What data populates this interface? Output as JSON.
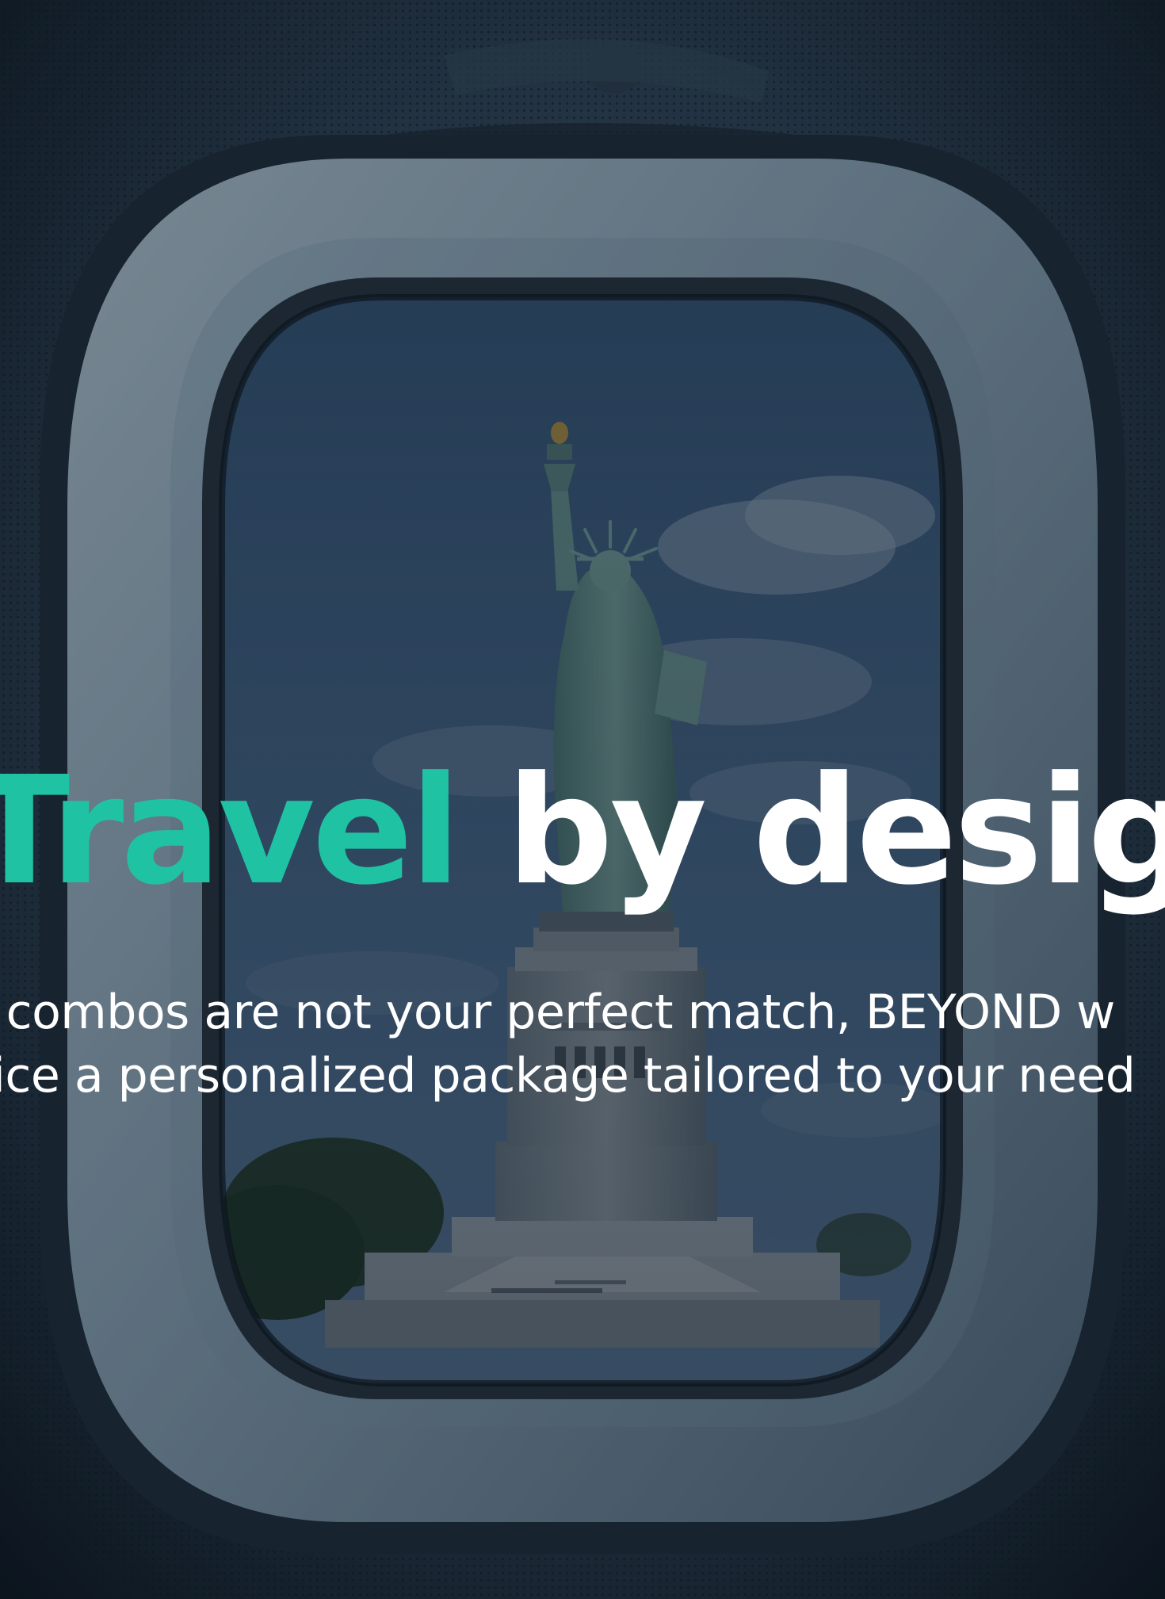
{
  "headline": {
    "accent_word": "Travel",
    "rest": " by design"
  },
  "subcopy": {
    "line1": "t combos are not your perfect match, BEYOND w",
    "line2": "rice a personalized package tailored to your need"
  },
  "colors": {
    "accent": "#1fc3a4",
    "text": "#ffffff",
    "sky": "#4f7399",
    "statue": "#6fa29c",
    "window_frame": "#7f97a8",
    "cabin_wall": "#33495c"
  },
  "imagery": {
    "scene": "airplane-window",
    "subject": "statue-of-liberty-icon"
  }
}
